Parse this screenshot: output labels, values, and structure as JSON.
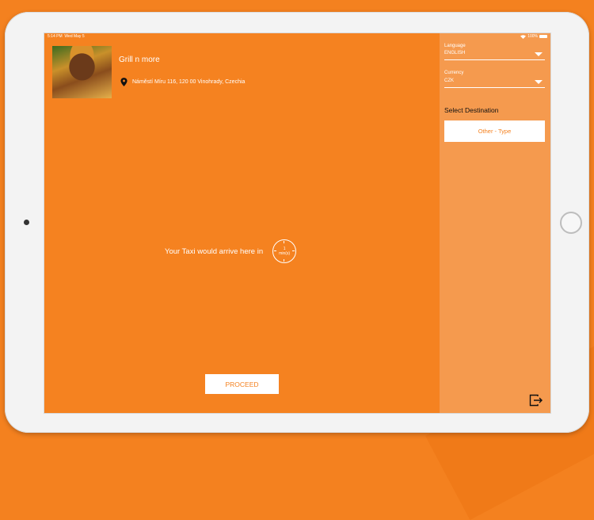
{
  "status": {
    "time": "5:14 PM",
    "date": "Wed May 5",
    "battery": "100%"
  },
  "restaurant": {
    "name": "Grill n more",
    "address": "Náměstí Míru 116, 120 00 Vinohrady, Czechia"
  },
  "eta": {
    "text": "Your Taxi would arrive here in",
    "value": "1",
    "unit": "min(s)"
  },
  "actions": {
    "proceed": "PROCEED"
  },
  "sidebar": {
    "language_label": "Language",
    "language_value": "ENGLISH",
    "currency_label": "Currency",
    "currency_value": "CZK",
    "destination_title": "Select Destination",
    "destination_option": "Other - Type"
  },
  "colors": {
    "brand": "#f58220",
    "sidebar": "#f59a4e"
  },
  "icons": [
    "location-pin-icon",
    "clock-icon",
    "chevron-down-icon",
    "logout-icon",
    "wifi-icon",
    "battery-icon"
  ]
}
